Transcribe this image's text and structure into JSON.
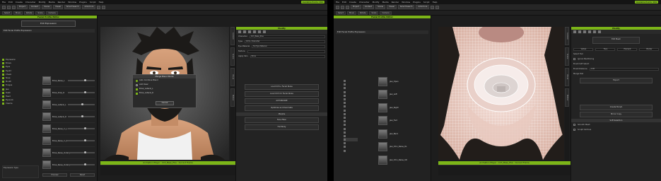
{
  "left": {
    "menu": [
      "File",
      "Edit",
      "Create",
      "Character",
      "Modify",
      "Media",
      "Render",
      "Window",
      "Plugins",
      "Script",
      "Help"
    ],
    "app_badge": "Available Points: 999",
    "toolbar": [
      "Project",
      "Content",
      "Scene",
      "Visual",
      "Smart Search",
      "ActorCore"
    ],
    "toolbar2": [
      "Select",
      "Move",
      "Rotate",
      "Scale",
      "Camera"
    ],
    "left_panel": {
      "title": "Facial Profile Editor",
      "edit_button": "Edit Expression",
      "tree_header": "Edit Facial Profile Expression",
      "tree": [
        "Expression",
        "Brows",
        "Eyes",
        "Eyelid",
        "Cheek",
        "Nose",
        "Mouth",
        "Tongue",
        "Jaw",
        "Teeth",
        "Head",
        "EyeLook",
        "Viseme"
      ],
      "sliders": [
        {
          "label": "Brow_Raise_L",
          "value": 0.6
        },
        {
          "label": "Brow_Drop_R",
          "value": 0.6
        },
        {
          "label": "Brow_Lateral_L",
          "value": 0.5
        },
        {
          "label": "Brow_Lateral_R",
          "value": 0.5
        },
        {
          "label": "Brow_Raise_In_L",
          "value": 0.6
        },
        {
          "label": "Brow_Raise_In_R",
          "value": 0.6
        },
        {
          "label": "Brow_Raise_Outer_L",
          "value": 0.6
        },
        {
          "label": "Brow_Raise_Outer_R",
          "value": 0.6
        }
      ],
      "bottom_buttons": [
        "Preview",
        "Reset"
      ],
      "bottom_left_label": "Expression Type"
    },
    "dialog": {
      "title": "Merge Blend Mode",
      "rows": [
        "Auto Combine Blend",
        "Add Clear",
        "Brow_Lateral_L",
        "Brow_Lateral_R"
      ],
      "button": "Cancel"
    },
    "right_panel": {
      "title": "Modify",
      "fields": [
        {
          "label": "Character",
          "value": "CC3_Base_Plus"
        },
        {
          "label": "Type",
          "value": "CC3+ Character"
        },
        {
          "label": "Eye Material",
          "value": "Far Eye Material"
        },
        {
          "label": "Texture",
          "value": ""
        },
        {
          "label": "Apply Skin",
          "value": "None"
        }
      ],
      "buttons": [
        "Load CC3+ Facial Rules",
        "Load CC3 CC Facial Rules",
        "ACTORCORE",
        "Optimize and Decimate"
      ],
      "section": "Morphs",
      "tail": [
        "Face Filter",
        "Full Body"
      ]
    },
    "anim_player": "Animation Player : CC3_Base_Plus : Current Frame",
    "side_tabs": [
      "Content",
      "Scene",
      "Visual",
      "Motion"
    ]
  },
  "right": {
    "menu": [
      "File",
      "Edit",
      "Create",
      "Character",
      "Modify",
      "Media",
      "Render",
      "Window",
      "Plugins",
      "Script",
      "Help"
    ],
    "app_badge": "Available Points: 999",
    "toolbar": [
      "Project",
      "Content",
      "Scene",
      "Visual",
      "Smart Search",
      "ActorCore"
    ],
    "toolbar2": [
      "Select",
      "Move",
      "Rotate",
      "Scale",
      "Camera"
    ],
    "left_panel": {
      "title": "Facial Profile Editor",
      "tree_header": "Edit Facial Profile Expression",
      "thumbs": [
        "Jaw_Open",
        "Jaw_Left",
        "Jaw_Right",
        "Jaw_Fwd",
        "Jaw_Back",
        "Jaw_Chin_Raise_DL",
        "Jaw_Chin_Raise_UR"
      ]
    },
    "right_panel": {
      "title": "Modify",
      "edit_button": "Edit Mesh",
      "tabs": [
        "Vertex",
        "Face",
        "Element",
        "Border"
      ],
      "fields": [
        {
          "label": "Select Tool",
          "value": ""
        },
        {
          "label": "Ignore Backfacing",
          "value": ""
        },
        {
          "label": "Brush Soft Select",
          "value": ""
        },
        {
          "label": "Brush Distance",
          "value": "1.00"
        },
        {
          "label": "Merge Dist",
          "value": ""
        }
      ],
      "buttons": [
        "Export",
        "Create Morph",
        "Mirror Copy",
        "Smooth Mesh"
      ],
      "section": "Soft Selection",
      "tail": [
        "Smooth Mesh",
        "Sculpt Vertices"
      ]
    },
    "anim_player": "Animation Player : CC3_Base_Plus : Current Frame",
    "side_tabs": [
      "Content",
      "Scene",
      "Visual",
      "Motion"
    ]
  },
  "colors": {
    "accent": "#7cb518",
    "panel": "#232323",
    "background": "#1d1d1d"
  }
}
